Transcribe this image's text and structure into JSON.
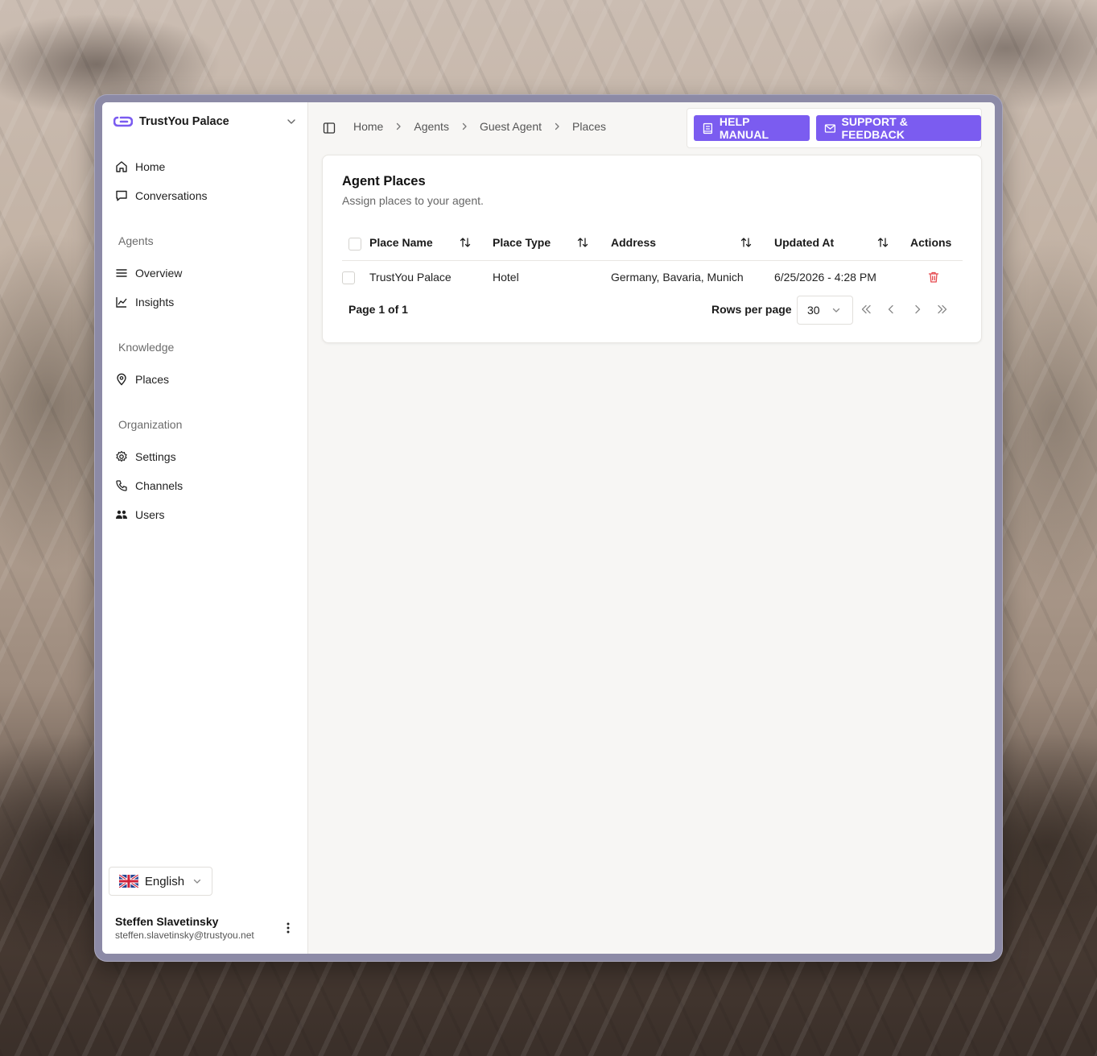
{
  "sidebar": {
    "org_name": "TrustYou Palace",
    "items_top": [
      {
        "label": "Home",
        "icon": "home-icon"
      },
      {
        "label": "Conversations",
        "icon": "chat-bubble-icon"
      }
    ],
    "groups": [
      {
        "title": "Agents",
        "items": [
          {
            "label": "Overview",
            "icon": "list-icon"
          },
          {
            "label": "Insights",
            "icon": "line-chart-icon"
          }
        ]
      },
      {
        "title": "Knowledge",
        "items": [
          {
            "label": "Places",
            "icon": "map-pin-icon"
          }
        ]
      },
      {
        "title": "Organization",
        "items": [
          {
            "label": "Settings",
            "icon": "gear-icon"
          },
          {
            "label": "Channels",
            "icon": "phone-icon"
          },
          {
            "label": "Users",
            "icon": "users-icon"
          }
        ]
      }
    ],
    "language": "English",
    "user": {
      "name": "Steffen Slavetinsky",
      "email": "steffen.slavetinsky@trustyou.net"
    }
  },
  "header": {
    "breadcrumb": [
      "Home",
      "Agents",
      "Guest Agent",
      "Places"
    ],
    "help_label": "HELP MANUAL",
    "support_label": "SUPPORT & FEEDBACK"
  },
  "card": {
    "title": "Agent Places",
    "description": "Assign places to your agent.",
    "columns": [
      "Place Name",
      "Place Type",
      "Address",
      "Updated At",
      "Actions"
    ],
    "rows": [
      {
        "place_name": "TrustYou Palace",
        "place_type": "Hotel",
        "address": "Germany, Bavaria, Munich",
        "updated_at": "6/25/2026 - 4:28 PM"
      }
    ],
    "pagination": {
      "page_info": "Page 1 of 1",
      "rows_per_page_label": "Rows per page",
      "rows_per_page": "30"
    }
  },
  "colors": {
    "accent": "#7b5cf0",
    "danger": "#e5484d"
  }
}
